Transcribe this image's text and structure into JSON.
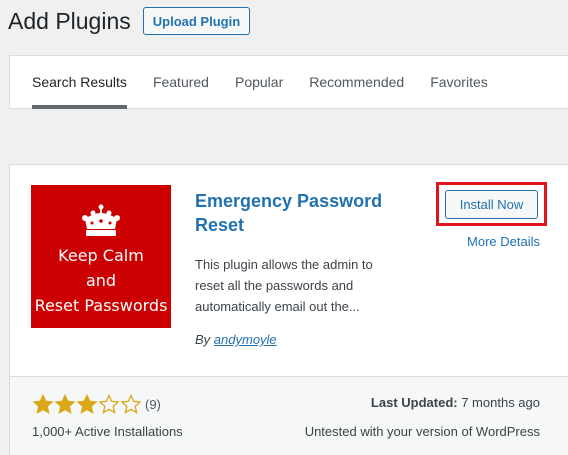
{
  "header": {
    "title": "Add Plugins",
    "upload_label": "Upload Plugin"
  },
  "tabs": [
    {
      "label": "Search Results",
      "active": true
    },
    {
      "label": "Featured",
      "active": false
    },
    {
      "label": "Popular",
      "active": false
    },
    {
      "label": "Recommended",
      "active": false
    },
    {
      "label": "Favorites",
      "active": false
    }
  ],
  "plugin": {
    "icon_text": "Keep Calm\nand\nReset Passwords",
    "name": "Emergency Password Reset",
    "description": "This plugin allows the admin to reset all the passwords and automatically email out the...",
    "author_prefix": "By",
    "author": "andymoyle",
    "install_label": "Install Now",
    "more_details_label": "More Details",
    "rating": 3,
    "rating_max": 5,
    "rating_count": "(9)",
    "active_installs": "1,000+ Active Installations",
    "last_updated_label": "Last Updated:",
    "last_updated_value": "7 months ago",
    "compatibility": "Untested with your version of WordPress"
  },
  "colors": {
    "accent": "#2271b1",
    "icon_bg": "#cc0000",
    "highlight_box": "#e0141e",
    "star": "#dba617"
  },
  "icons": [
    "crown-icon",
    "star-filled-icon",
    "star-empty-icon"
  ]
}
